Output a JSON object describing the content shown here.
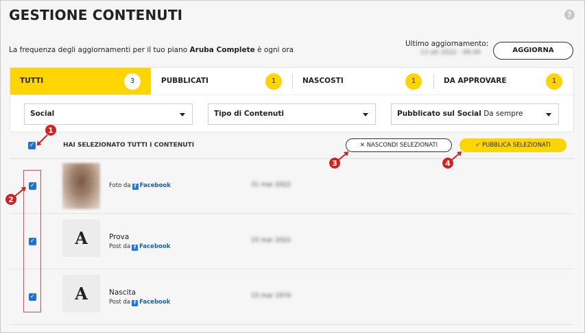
{
  "page": {
    "title": "GESTIONE CONTENUTI",
    "help_icon": "?"
  },
  "info": {
    "freq_prefix": "La frequenza degli aggiornamenti per il tuo piano ",
    "plan_name": "Aruba Complete",
    "freq_suffix": " è ogni ora",
    "last_update_label": "Ultimo aggiornamento:",
    "last_update_value": "13 ott 2022 - 08:49",
    "refresh_label": "AGGIORNA"
  },
  "tabs": [
    {
      "label": "TUTTI",
      "count": "3"
    },
    {
      "label": "PUBBLICATI",
      "count": "1"
    },
    {
      "label": "NASCOSTI",
      "count": "1"
    },
    {
      "label": "DA APPROVARE",
      "count": "1"
    }
  ],
  "filters": {
    "social": {
      "label": "Social",
      "value": ""
    },
    "content_type": {
      "label": "Tipo di Contenuti",
      "value": ""
    },
    "published": {
      "label": "Pubblicato sul Social",
      "value": "Da sempre"
    }
  },
  "selection": {
    "select_all_text": "HAI SELEZIONATO TUTTI I CONTENUTI",
    "hide_selected": "NASCONDI SELEZIONATI",
    "publish_selected": "PUBBLICA SELEZIONATI"
  },
  "rows": [
    {
      "thumb": "",
      "title": "",
      "source_prefix": "Foto da",
      "source": "Facebook",
      "date": "31 mar 2022",
      "checked": true
    },
    {
      "thumb": "A",
      "title": "Prova",
      "source_prefix": "Post da",
      "source": "Facebook",
      "date": "15 mar 2022",
      "checked": true
    },
    {
      "thumb": "A",
      "title": "Nascita",
      "source_prefix": "Post da",
      "source": "Facebook",
      "date": "15 mar 1974",
      "checked": true
    }
  ],
  "callouts": [
    "1",
    "2",
    "3",
    "4"
  ],
  "colors": {
    "accent_yellow": "#ffd500",
    "checkbox_blue": "#1e6fd9",
    "callout_red": "#d81f1f",
    "facebook_blue": "#1877f2"
  }
}
